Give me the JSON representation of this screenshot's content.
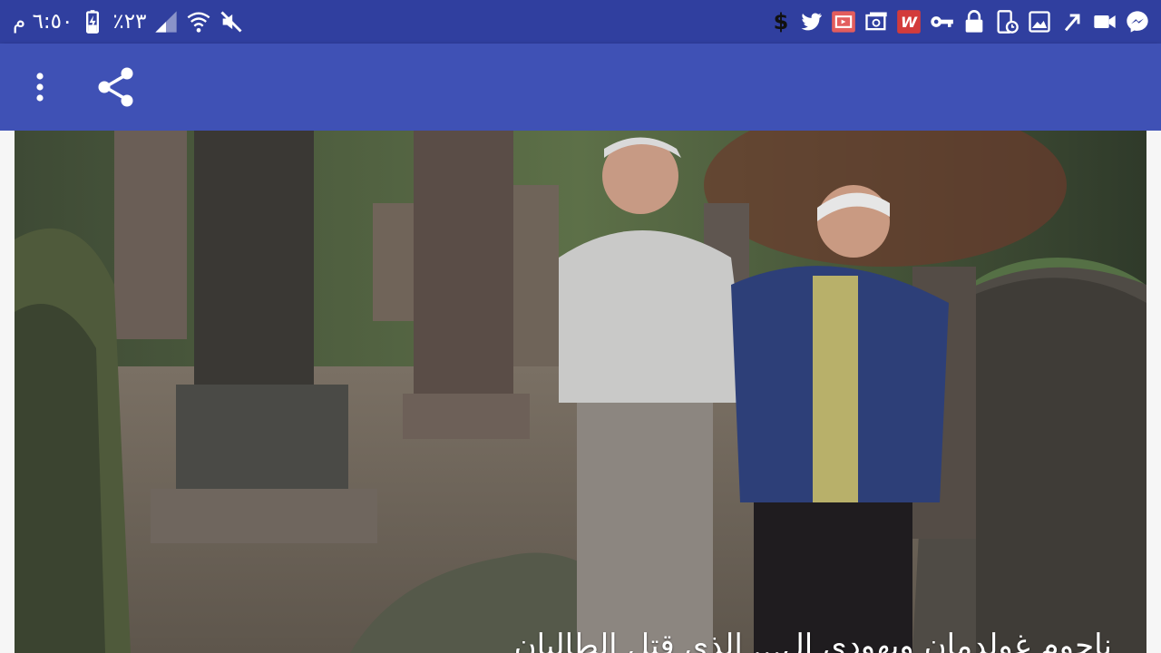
{
  "status_bar": {
    "time": "٦:٥٠ م",
    "battery": "٪٢٣",
    "left_icons": [
      "battery-icon",
      "signal-icon",
      "wifi-icon",
      "mute-icon"
    ],
    "right_icons": [
      "dollar-icon",
      "twitter-icon",
      "cast-app-icon",
      "email-app-icon",
      "office-app-icon",
      "vpn-key-icon",
      "lock-icon",
      "screen-time-icon",
      "gallery-icon",
      "missed-call-icon",
      "video-icon",
      "messenger-icon"
    ],
    "dollar_glyph": "$",
    "office_letter": "W"
  },
  "toolbar": {
    "overflow_icon": "more-vert-icon",
    "share_icon": "share-icon"
  },
  "content": {
    "caption": "ناحوم غولدمان ويهودي ال... الذي قتل الطالبان",
    "image": "cemetery-photo"
  },
  "colors": {
    "status_bar": "#303f9f",
    "toolbar": "#3f51b5",
    "background": "#f6f6f6"
  }
}
